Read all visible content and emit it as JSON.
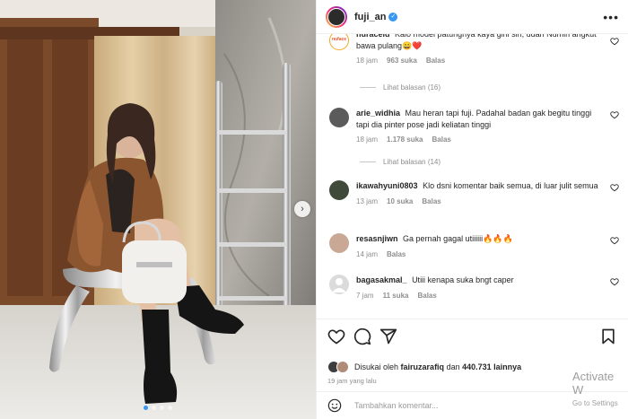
{
  "post": {
    "author": "fuji_an",
    "likes_prefix": "Disukai oleh",
    "likes_user": "fairuzarafiq",
    "likes_joiner": "dan",
    "likes_count": "440.731 lainnya",
    "time": "19 jam yang lalu"
  },
  "comments": [
    {
      "user": "nuraceld",
      "text": "Kalo model patungnya kaya gini sih, udah Numin angkut bawa pulang😄❤️",
      "time": "18 jam",
      "likes": "963 suka",
      "reply": "Balas",
      "view_replies": "Lihat balasan (16)",
      "avatar_text": "nuface"
    },
    {
      "user": "arie_widhia",
      "text": "Mau heran tapi fuji. Padahal badan gak begitu tinggi tapi dia pinter pose jadi keliatan tinggi",
      "time": "18 jam",
      "likes": "1.178 suka",
      "reply": "Balas",
      "view_replies": "Lihat balasan (14)"
    },
    {
      "user": "ikawahyuni0803",
      "text": "Klo dsni komentar baik semua, di luar julit semua",
      "time": "13 jam",
      "likes": "10 suka",
      "reply": "Balas"
    },
    {
      "user": "resasnjiwn",
      "text": "Ga pernah gagal utiiiiii🔥🔥🔥",
      "time": "14 jam",
      "reply": "Balas"
    },
    {
      "user": "bagasakmal_",
      "text": "Utiii kenapa suka bngt caper",
      "time": "7 jam",
      "likes": "11 suka",
      "reply": "Balas"
    }
  ],
  "comment_box": {
    "placeholder": "Tambahkan komentar..."
  },
  "watermark": {
    "title": "Activate W",
    "subtitle": "Go to Settings"
  },
  "colors": {
    "accent": "#3897f0",
    "muted": "#8e8e8e",
    "text": "#262626",
    "heart_red": "#ed4956"
  },
  "icons": [
    "verified-badge-icon",
    "more-options-icon",
    "heart-icon",
    "comment-icon",
    "share-icon",
    "bookmark-icon",
    "emoji-icon",
    "chevron-right-icon"
  ]
}
